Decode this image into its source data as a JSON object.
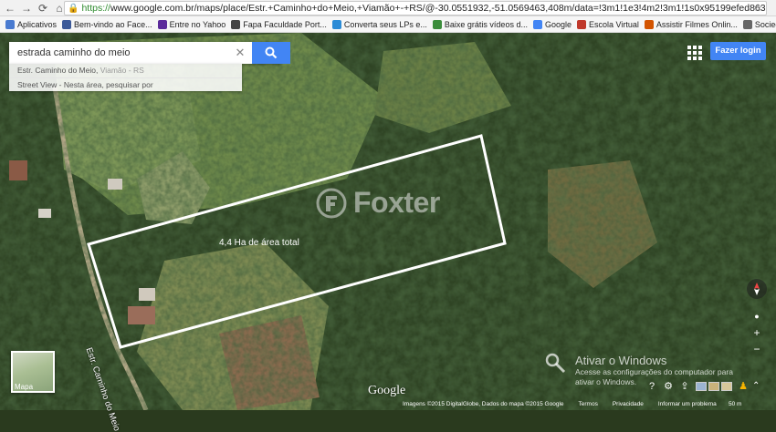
{
  "browser": {
    "url_scheme": "https://",
    "url_rest": "www.google.com.br/maps/place/Estr.+Caminho+do+Meio,+Viamão+-+RS/@-30.0551932,-51.0569463,408m/data=!3m1!1e3!4m2!3m1!1s0x95199efed863b",
    "bookmarks": [
      {
        "label": "Aplicativos",
        "icon_color": "#4a7bd0",
        "icon": "apps-icon"
      },
      {
        "label": "Bem-vindo ao Face...",
        "icon_color": "#3b5998",
        "icon": "facebook-icon"
      },
      {
        "label": "Entre no Yahoo",
        "icon_color": "#5b2a9b",
        "icon": "yahoo-icon"
      },
      {
        "label": "Fapa Faculdade Port...",
        "icon_color": "#444444",
        "icon": "page-icon"
      },
      {
        "label": "Converta seus LPs e...",
        "icon_color": "#2b8bd6",
        "icon": "cloud-icon"
      },
      {
        "label": "Baixe grátis vídeos d...",
        "icon_color": "#3c8d3c",
        "icon": "download-icon"
      },
      {
        "label": "Google",
        "icon_color": "#4285f4",
        "icon": "google-icon"
      },
      {
        "label": "Escola Virtual",
        "icon_color": "#c0392b",
        "icon": "school-icon"
      },
      {
        "label": "Assistir Filmes Onlin...",
        "icon_color": "#d35400",
        "icon": "film-icon"
      },
      {
        "label": "Sociedade Brasileira ...",
        "icon_color": "#666666",
        "icon": "page-icon"
      }
    ]
  },
  "search": {
    "value": "estrada caminho do meio",
    "suggestions": [
      {
        "main": "Estr. Caminho do Meio, ",
        "dim": "Viamão - RS"
      },
      {
        "main": "Street View - Nesta área, pesquisar por",
        "dim": ""
      }
    ]
  },
  "header": {
    "login_label": "Fazer login"
  },
  "map": {
    "watermark": "Foxter",
    "area_label": "4,4 Ha de área total",
    "road_label": "Estr. Caminho do Meio",
    "thumbnail_label": "Mapa",
    "google_logo": "Google",
    "attribution": [
      "Imagens ©2015 DigitalGlobe, Dados do mapa ©2015 Google",
      "Termos",
      "Privacidade",
      "Informar um problema"
    ],
    "scale": "50 m",
    "boundary_color": "#ffffff"
  },
  "windows_activation": {
    "title": "Ativar o Windows",
    "line1": "Acesse as configurações do computador para",
    "line2": "ativar o Windows."
  },
  "colors": {
    "accent": "#4285f4"
  }
}
